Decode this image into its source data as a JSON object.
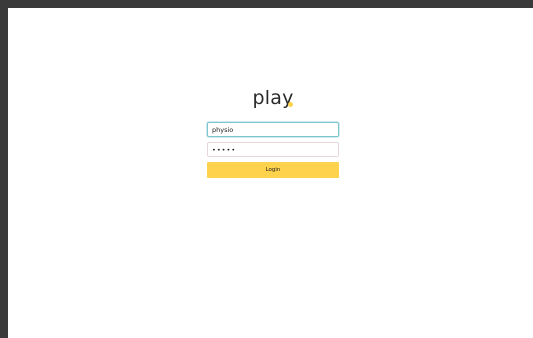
{
  "brand": {
    "logo_text": "play",
    "accent": "#ffd24d",
    "logo_icon": "dot-icon"
  },
  "form": {
    "username_value": "physio",
    "password_value": "•••••",
    "login_label": "Login",
    "button_color": "#ffd24d",
    "focus_color": "#7ec6cf"
  }
}
